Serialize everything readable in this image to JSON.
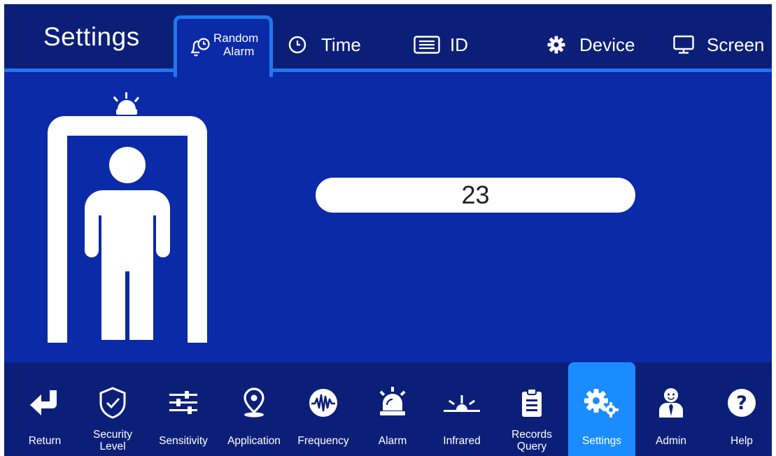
{
  "header": {
    "title": "Settings",
    "tabs": [
      {
        "id": "random-alarm",
        "line1": "Random",
        "line2": "Alarm",
        "icon": "alarm-clock-icon",
        "active": true
      },
      {
        "id": "time",
        "label": "Time",
        "icon": "clock-icon"
      },
      {
        "id": "id",
        "label": "ID",
        "icon": "id-list-icon"
      },
      {
        "id": "device",
        "label": "Device",
        "icon": "gear-icon"
      },
      {
        "id": "screen",
        "label": "Screen",
        "icon": "monitor-icon"
      }
    ]
  },
  "main": {
    "value": "23",
    "illustration": "walk-through-gate-icon"
  },
  "nav": {
    "items": [
      {
        "label": "Return",
        "icon": "return-arrow-icon"
      },
      {
        "label": "Security\nLevel",
        "icon": "shield-check-icon"
      },
      {
        "label": "Sensitivity",
        "icon": "sliders-icon"
      },
      {
        "label": "Application",
        "icon": "location-pin-icon"
      },
      {
        "label": "Frequency",
        "icon": "waveform-icon"
      },
      {
        "label": "Alarm",
        "icon": "siren-icon"
      },
      {
        "label": "Infrared",
        "icon": "infrared-icon"
      },
      {
        "label": "Records\nQuery",
        "icon": "clipboard-icon"
      },
      {
        "label": "Settings",
        "icon": "gears-icon",
        "active": true
      },
      {
        "label": "Admin",
        "icon": "admin-person-icon"
      },
      {
        "label": "Help",
        "icon": "help-icon"
      }
    ]
  },
  "colors": {
    "background": "#0b2aa8",
    "bars": "#0c1f78",
    "accent": "#1f78f0",
    "active_nav": "#1a8cff"
  }
}
